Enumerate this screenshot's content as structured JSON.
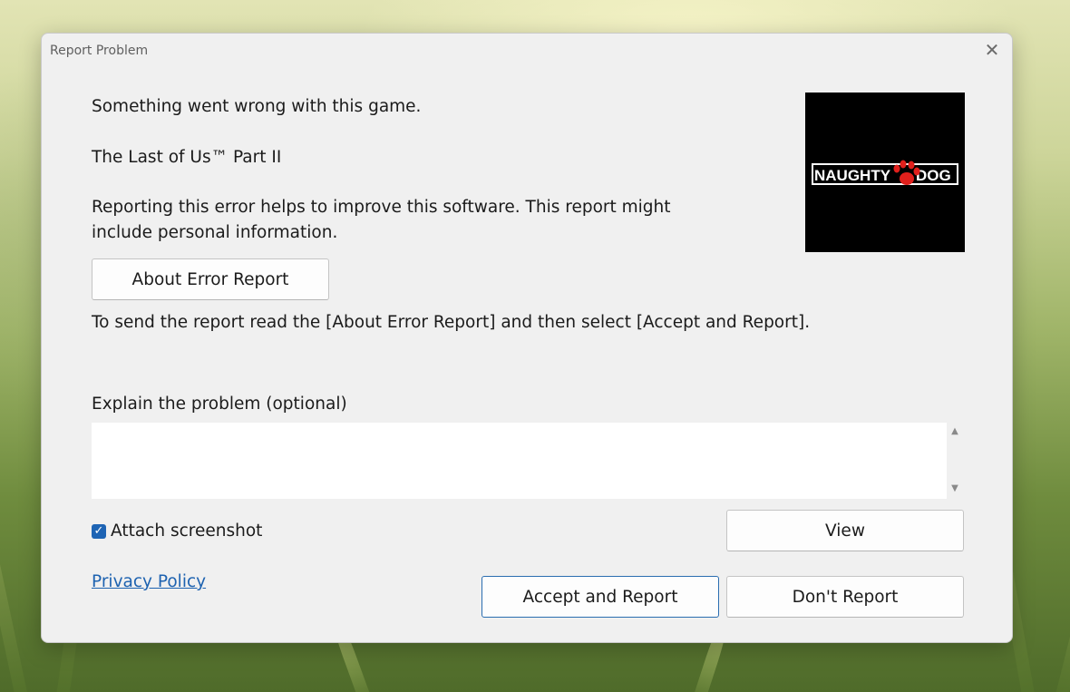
{
  "dialog": {
    "title": "Report Problem",
    "close_glyph": "✕"
  },
  "message": {
    "line1": "Something went wrong with this game.",
    "game_title": "The Last of Us™ Part II",
    "info": "Reporting this error helps to improve this software. This report might include personal information.",
    "instruction": "To send the report read the [About Error Report] and then select [Accept and Report]."
  },
  "logo": {
    "text_left": "NAUGHTY",
    "text_right": "DOG",
    "icon": "paw-icon",
    "paw_color": "#e0201c"
  },
  "buttons": {
    "about": "About Error Report",
    "view": "View",
    "accept": "Accept and Report",
    "dont_report": "Don't Report"
  },
  "explain": {
    "label": "Explain the problem (optional)",
    "value": "",
    "placeholder": ""
  },
  "attach": {
    "label": "Attach screenshot",
    "checked": true
  },
  "privacy_link": "Privacy Policy",
  "colors": {
    "accent": "#1e64b4",
    "link": "#1d62b0",
    "dialog_bg": "#f0f0f0"
  }
}
